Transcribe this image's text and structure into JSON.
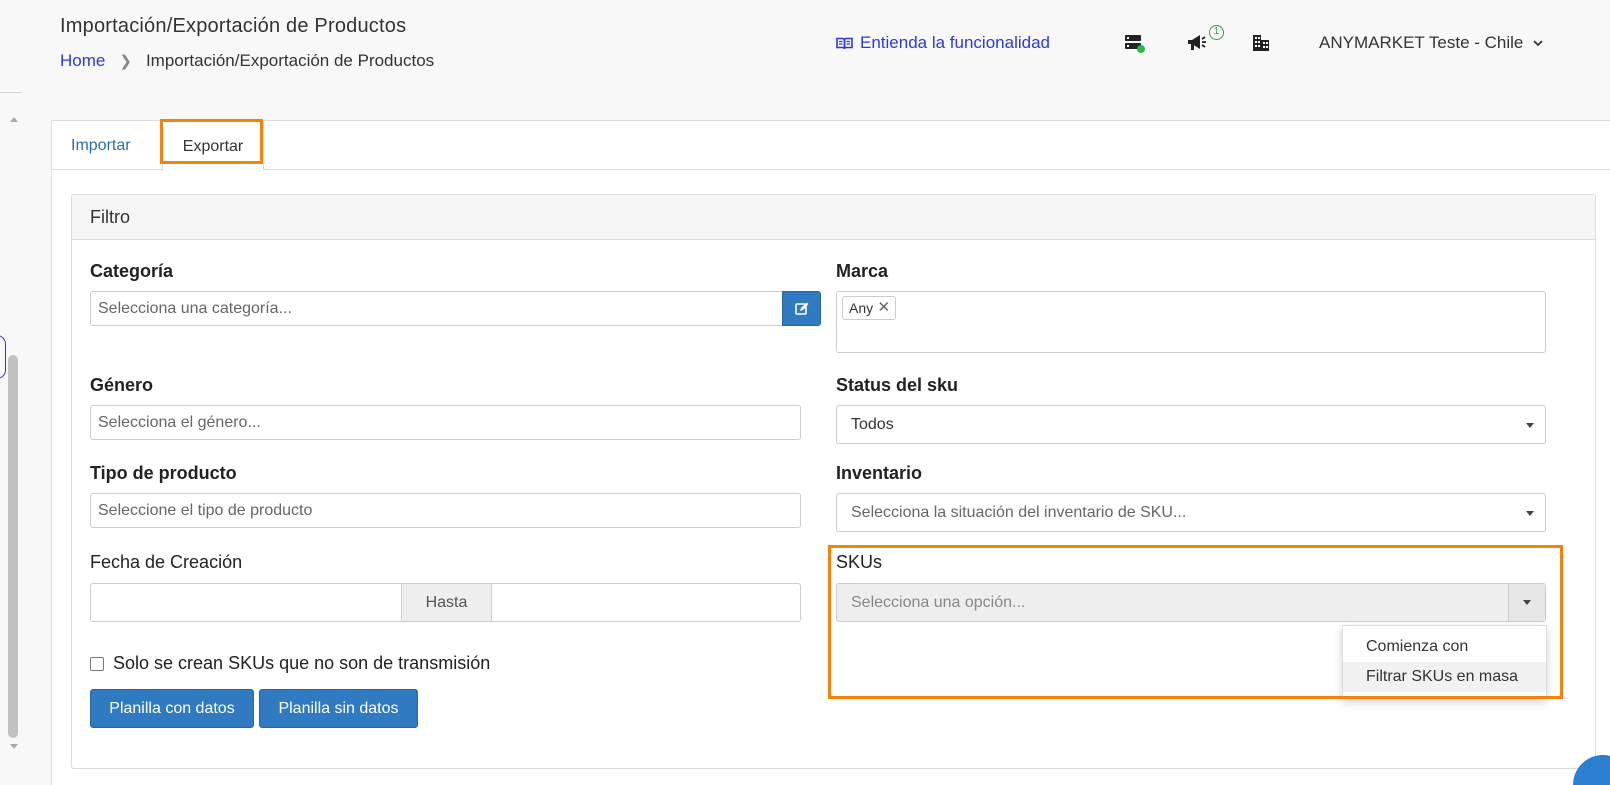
{
  "header": {
    "title": "Importación/Exportación de Productos",
    "breadcrumb": {
      "home": "Home",
      "current": "Importación/Exportación de Productos"
    },
    "help_link": "Entienda la funcionalidad",
    "notification_count": "1",
    "account": "ANYMARKET Teste - Chile"
  },
  "tabs": [
    {
      "label": "Importar"
    },
    {
      "label": "Exportar"
    }
  ],
  "filter": {
    "title": "Filtro",
    "categoria": {
      "label": "Categoría",
      "placeholder": "Selecciona una categoría..."
    },
    "marca": {
      "label": "Marca",
      "tag": "Any"
    },
    "genero": {
      "label": "Género",
      "placeholder": "Selecciona el género..."
    },
    "status": {
      "label": "Status del sku",
      "value": "Todos"
    },
    "tipo": {
      "label": "Tipo de producto",
      "placeholder": "Seleccione el tipo de producto"
    },
    "inventario": {
      "label": "Inventario",
      "placeholder": "Selecciona la situación del inventario de SKU..."
    },
    "fecha": {
      "label": "Fecha de Creación",
      "addon": "Hasta"
    },
    "skus": {
      "label": "SKUs",
      "placeholder": "Selecciona una opción...",
      "options": [
        "Comienza con",
        "Filtrar SKUs en masa"
      ]
    },
    "checkbox_label": "Solo se crean SKUs que no son de transmisión",
    "buttons": {
      "with_data": "Planilla con datos",
      "without_data": "Planilla sin datos"
    }
  },
  "colors": {
    "accent": "#2b3bd9",
    "primary": "#2f7ac0",
    "highlight": "#f5820b"
  }
}
